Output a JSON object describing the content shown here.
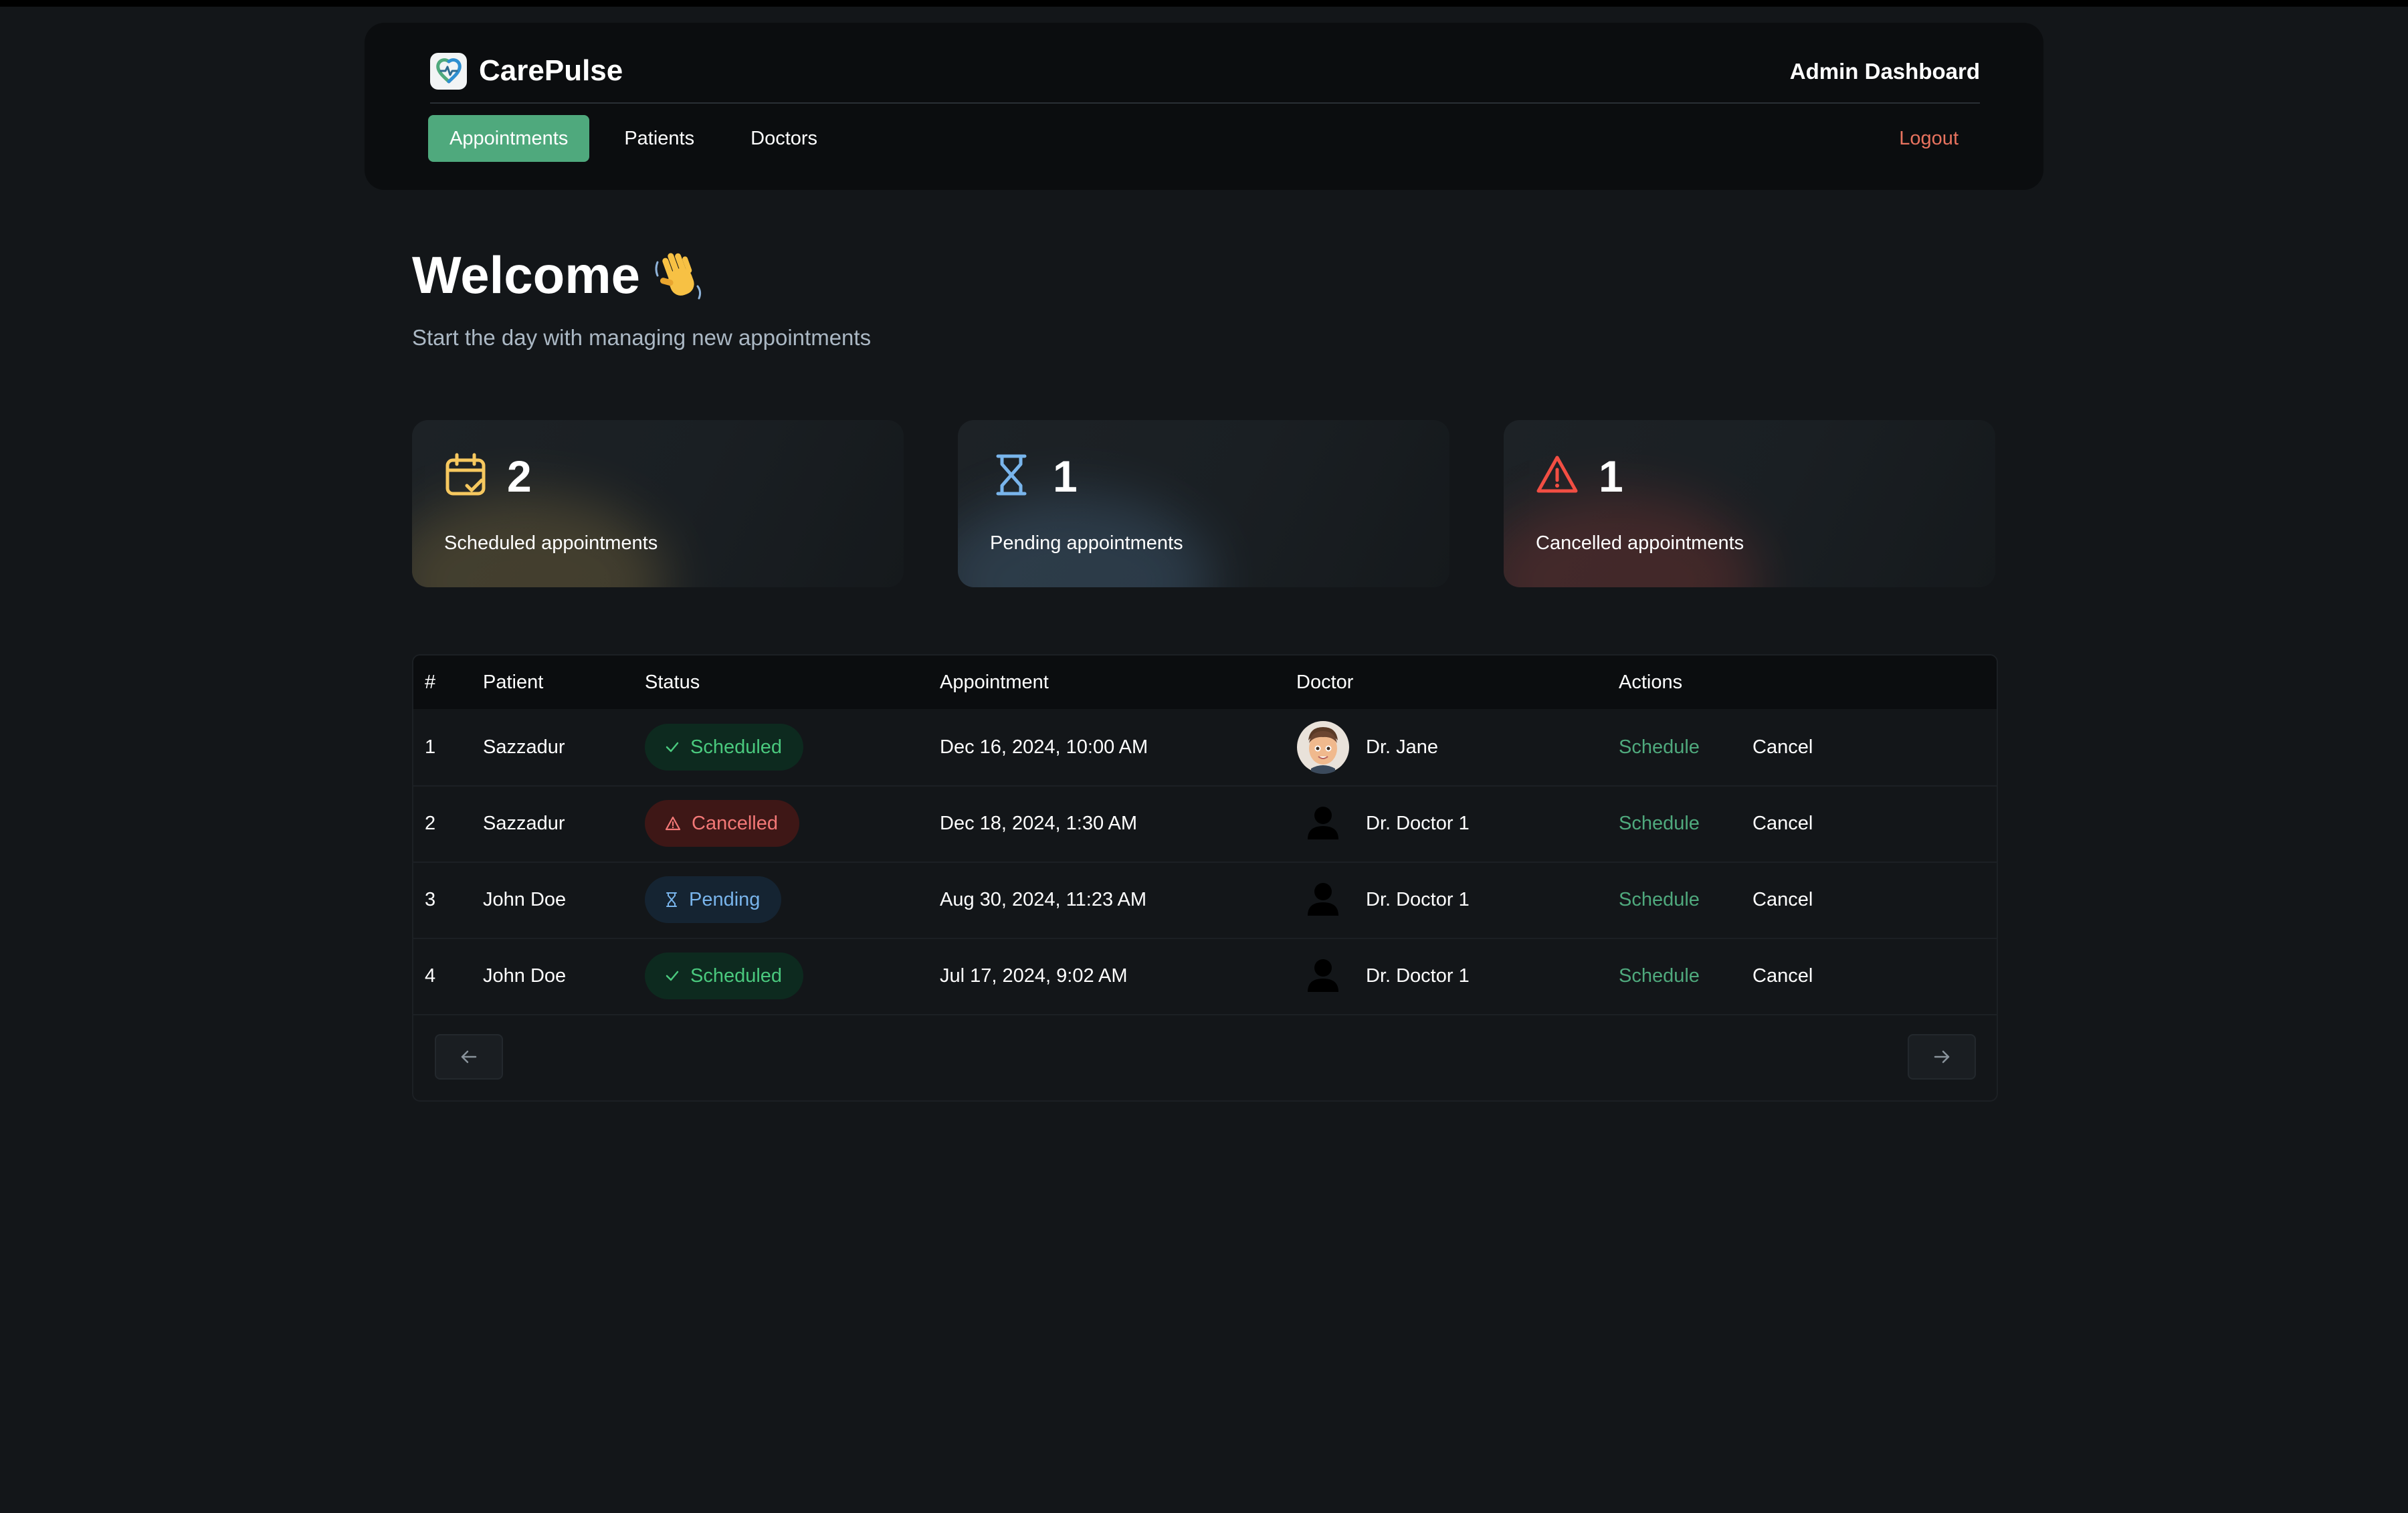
{
  "app": {
    "name": "CarePulse",
    "header_title": "Admin Dashboard"
  },
  "nav": {
    "items": [
      {
        "label": "Appointments",
        "active": true
      },
      {
        "label": "Patients",
        "active": false
      },
      {
        "label": "Doctors",
        "active": false
      }
    ],
    "logout_label": "Logout"
  },
  "welcome": {
    "title": "Welcome",
    "subtitle": "Start the day with managing new appointments"
  },
  "stats": [
    {
      "icon": "calendar-check-icon",
      "count": "2",
      "label": "Scheduled appointments",
      "color": "#f6c85f"
    },
    {
      "icon": "hourglass-icon",
      "count": "1",
      "label": "Pending appointments",
      "color": "#79b5ec"
    },
    {
      "icon": "alert-triangle-icon",
      "count": "1",
      "label": "Cancelled appointments",
      "color": "#f24e43"
    }
  ],
  "table": {
    "headers": [
      "#",
      "Patient",
      "Status",
      "Appointment",
      "Doctor",
      "Actions"
    ],
    "rows": [
      {
        "index": "1",
        "patient": "Sazzadur",
        "status": "Scheduled",
        "appointment": "Dec 16, 2024, 10:00 AM",
        "doctor": "Dr. Jane",
        "avatar": "memoji-avatar",
        "schedule": "Schedule",
        "cancel": "Cancel"
      },
      {
        "index": "2",
        "patient": "Sazzadur",
        "status": "Cancelled",
        "appointment": "Dec 18, 2024, 1:30 AM",
        "doctor": "Dr. Doctor 1",
        "avatar": "person-silhouette-icon",
        "schedule": "Schedule",
        "cancel": "Cancel"
      },
      {
        "index": "3",
        "patient": "John Doe",
        "status": "Pending",
        "appointment": "Aug 30, 2024, 11:23 AM",
        "doctor": "Dr. Doctor 1",
        "avatar": "person-silhouette-icon",
        "schedule": "Schedule",
        "cancel": "Cancel"
      },
      {
        "index": "4",
        "patient": "John Doe",
        "status": "Scheduled",
        "appointment": "Jul 17, 2024, 9:02 AM",
        "doctor": "Dr. Doctor 1",
        "avatar": "person-silhouette-icon",
        "schedule": "Schedule",
        "cancel": "Cancel"
      }
    ],
    "pagination": {
      "prev_icon": "arrow-left-icon",
      "next_icon": "arrow-right-icon"
    }
  },
  "colors": {
    "accent": "#4fa97d",
    "logout": "#e8735f",
    "background": "#131619"
  }
}
